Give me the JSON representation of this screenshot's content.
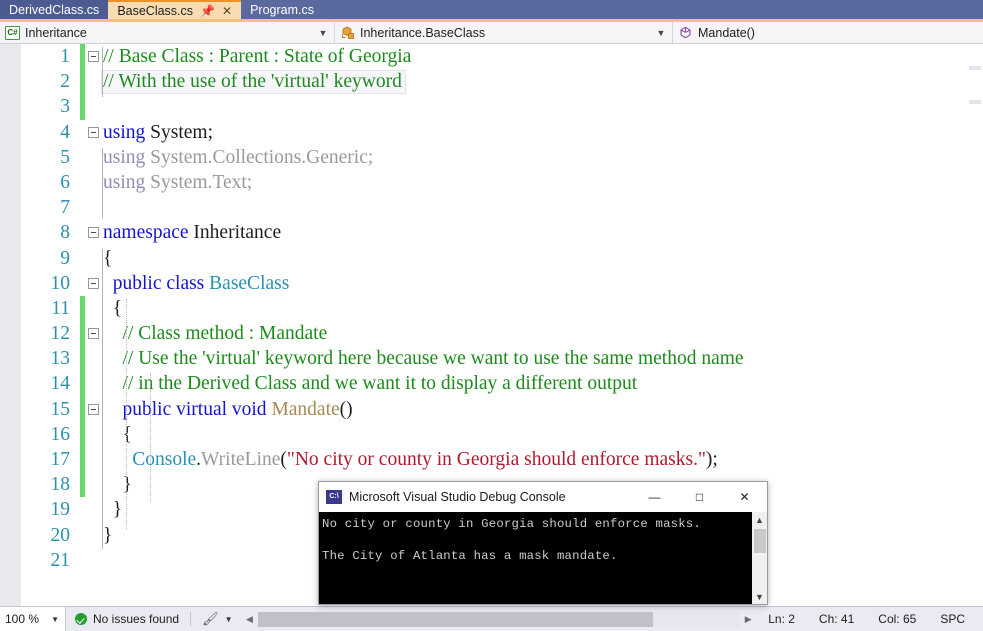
{
  "tabs": [
    {
      "label": "DerivedClass.cs",
      "active": false
    },
    {
      "label": "BaseClass.cs",
      "active": true,
      "pin_icon": "pin-icon",
      "close_icon": "close-icon"
    },
    {
      "label": "Program.cs",
      "active": false
    }
  ],
  "navbar": {
    "project": {
      "icon": "csharp-project-icon",
      "label": "Inheritance"
    },
    "type": {
      "icon": "class-icon",
      "label": "Inheritance.BaseClass"
    },
    "member": {
      "icon": "method-icon",
      "label": "Mandate()"
    },
    "dropdown_icon": "chevron-down-icon"
  },
  "editor": {
    "lines": [
      {
        "num": "1",
        "changed": true,
        "glyph": true,
        "indent": 0,
        "tokens": [
          {
            "t": "// Base Class : Parent : State of Georgia",
            "c": "c-comment"
          }
        ]
      },
      {
        "num": "2",
        "changed": true,
        "glyph": false,
        "indent": 0,
        "current": true,
        "tokens": [
          {
            "t": "// With the use of the 'virtual' keyword",
            "c": "c-comment"
          }
        ]
      },
      {
        "num": "3",
        "changed": true,
        "glyph": false,
        "indent": 0,
        "tokens": []
      },
      {
        "num": "4",
        "changed": false,
        "glyph": true,
        "indent": 0,
        "tokens": [
          {
            "t": "using ",
            "c": "c-keyword"
          },
          {
            "t": "System;",
            "c": "c-plain"
          }
        ]
      },
      {
        "num": "5",
        "changed": false,
        "glyph": false,
        "indent": 0,
        "tokens": [
          {
            "t": "using ",
            "c": "c-using-gray"
          },
          {
            "t": "System.Collections.Generic;",
            "c": "c-ns-gray"
          }
        ]
      },
      {
        "num": "6",
        "changed": false,
        "glyph": false,
        "indent": 0,
        "tokens": [
          {
            "t": "using ",
            "c": "c-using-gray"
          },
          {
            "t": "System.Text;",
            "c": "c-ns-gray"
          }
        ]
      },
      {
        "num": "7",
        "changed": false,
        "glyph": false,
        "indent": 0,
        "tokens": []
      },
      {
        "num": "8",
        "changed": false,
        "glyph": true,
        "indent": 0,
        "tokens": [
          {
            "t": "namespace ",
            "c": "c-keyword"
          },
          {
            "t": "Inheritance",
            "c": "c-plain"
          }
        ]
      },
      {
        "num": "9",
        "changed": false,
        "glyph": false,
        "indent": 0,
        "tokens": [
          {
            "t": "{",
            "c": "c-punct"
          }
        ]
      },
      {
        "num": "10",
        "changed": false,
        "glyph": true,
        "indent": 1,
        "tokens": [
          {
            "t": "  public class ",
            "c": "c-keyword"
          },
          {
            "t": "BaseClass",
            "c": "c-type"
          }
        ]
      },
      {
        "num": "11",
        "changed": true,
        "glyph": false,
        "indent": 1,
        "tokens": [
          {
            "t": "  {",
            "c": "c-punct"
          }
        ]
      },
      {
        "num": "12",
        "changed": true,
        "glyph": true,
        "indent": 2,
        "tokens": [
          {
            "t": "    // Class method : Mandate",
            "c": "c-comment"
          }
        ]
      },
      {
        "num": "13",
        "changed": true,
        "glyph": false,
        "indent": 2,
        "tokens": [
          {
            "t": "    // Use the 'virtual' keyword here because we want to use the same method name",
            "c": "c-comment"
          }
        ]
      },
      {
        "num": "14",
        "changed": true,
        "glyph": false,
        "indent": 2,
        "tokens": [
          {
            "t": "    // in the Derived Class and we want it to display a different output",
            "c": "c-comment"
          }
        ]
      },
      {
        "num": "15",
        "changed": true,
        "glyph": true,
        "indent": 2,
        "tokens": [
          {
            "t": "    public virtual void ",
            "c": "c-keyword"
          },
          {
            "t": "Mandate",
            "c": "c-method"
          },
          {
            "t": "()",
            "c": "c-punct"
          }
        ]
      },
      {
        "num": "16",
        "changed": true,
        "glyph": false,
        "indent": 2,
        "tokens": [
          {
            "t": "    {",
            "c": "c-punct"
          }
        ]
      },
      {
        "num": "17",
        "changed": true,
        "glyph": false,
        "indent": 3,
        "tokens": [
          {
            "t": "      ",
            "c": "c-plain"
          },
          {
            "t": "Console",
            "c": "c-consolename"
          },
          {
            "t": ".",
            "c": "c-punct"
          },
          {
            "t": "WriteLine",
            "c": "c-gray-member"
          },
          {
            "t": "(",
            "c": "c-punct"
          },
          {
            "t": "\"No city or county in Georgia should enforce masks.\"",
            "c": "c-string"
          },
          {
            "t": ");",
            "c": "c-punct"
          }
        ]
      },
      {
        "num": "18",
        "changed": true,
        "glyph": false,
        "indent": 2,
        "tokens": [
          {
            "t": "    }",
            "c": "c-punct"
          }
        ]
      },
      {
        "num": "19",
        "changed": false,
        "glyph": false,
        "indent": 1,
        "tokens": [
          {
            "t": "  }",
            "c": "c-punct"
          }
        ]
      },
      {
        "num": "20",
        "changed": false,
        "glyph": false,
        "indent": 0,
        "tokens": [
          {
            "t": "}",
            "c": "c-punct"
          }
        ]
      },
      {
        "num": "21",
        "changed": false,
        "glyph": false,
        "indent": 0,
        "tokens": []
      }
    ]
  },
  "console": {
    "icon": "console-app-icon",
    "title": "Microsoft Visual Studio Debug Console",
    "minimize_label": "—",
    "maximize_label": "□",
    "close_label": "✕",
    "output_lines": [
      "No city or county in Georgia should enforce masks.",
      "",
      "The City of Atlanta has a mask mandate."
    ],
    "scroll_up_icon": "chevron-up-icon",
    "scroll_down_icon": "chevron-down-icon"
  },
  "statusbar": {
    "zoom": "100 %",
    "zoom_arrow_icon": "chevron-down-icon",
    "issues_icon": "success-check-icon",
    "issues": "No issues found",
    "brush_icon": "brush-icon",
    "brush_arrow_icon": "chevron-down-icon",
    "scroll_left_icon": "chevron-left-icon",
    "scroll_right_icon": "chevron-right-icon",
    "line": "Ln: 2",
    "char": "Ch: 41",
    "col": "Col: 65",
    "spaces": "SPC"
  },
  "colors": {
    "tabbar_bg": "#5a6a9e",
    "active_tab_bg": "#f6dcb0",
    "active_tab_accent": "#e8912d",
    "comment": "#1d8a1d",
    "keyword": "#1414cf",
    "type": "#2b91af",
    "string": "#b01a2e",
    "method": "#a68a55",
    "changebar": "#67d96a",
    "status_ok": "#1f9d2f"
  }
}
